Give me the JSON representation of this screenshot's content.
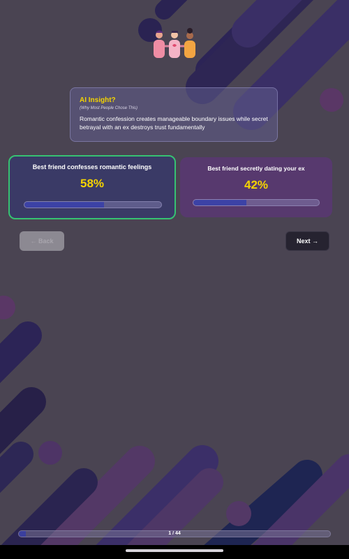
{
  "colors": {
    "background": "#4a4452",
    "accent_yellow": "#f5d400",
    "selected_border": "#36c272",
    "bar_fill": "#3c42a6"
  },
  "hero": {
    "icon": "friends-illustration-icon"
  },
  "insight": {
    "title": "AI Insight?",
    "subtitle": "(Why Most People Chose This)",
    "body": "Romantic confession creates manageable boundary issues while secret betrayal with an ex destroys trust fundamentally"
  },
  "options": [
    {
      "label": "Best friend confesses romantic feelings",
      "percent_text": "58%",
      "percent": 58,
      "selected": true
    },
    {
      "label": "Best friend secretly dating your ex",
      "percent_text": "42%",
      "percent": 42,
      "selected": false
    }
  ],
  "nav": {
    "back_label": "← Back",
    "next_label": "Next →"
  },
  "progress": {
    "text": "1 / 44",
    "current": 1,
    "total": 44
  }
}
